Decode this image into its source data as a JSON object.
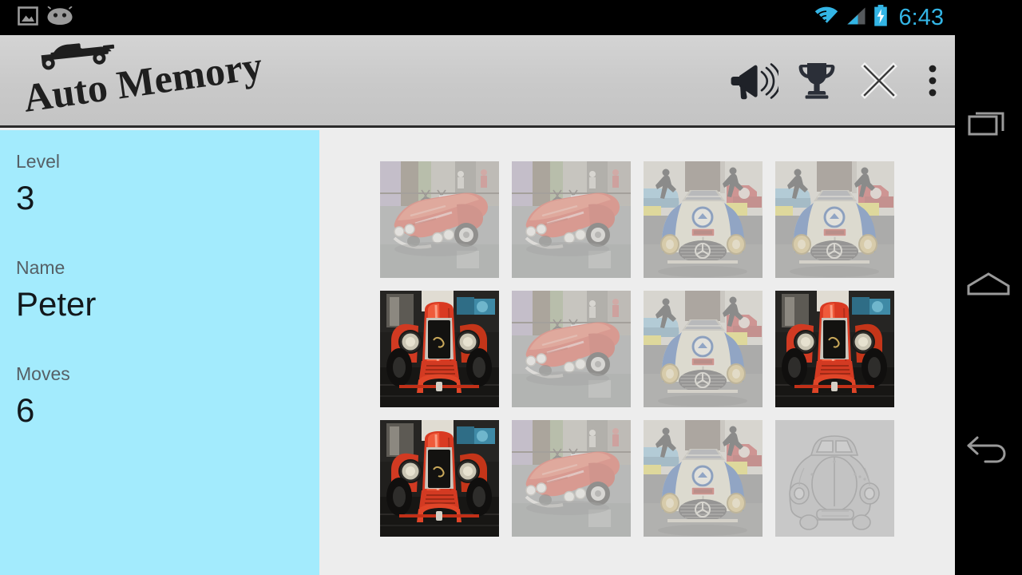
{
  "status_bar": {
    "time": "6:43",
    "left_icons": [
      {
        "name": "screenshot-icon",
        "label": "screenshot"
      },
      {
        "name": "android-bean-icon",
        "label": "android"
      }
    ],
    "right_icons": [
      {
        "name": "wifi-icon",
        "label": "wifi"
      },
      {
        "name": "cellular-signal-icon",
        "label": "signal"
      },
      {
        "name": "battery-charging-icon",
        "label": "battery charging"
      }
    ],
    "accent_color": "#33b5e5",
    "background_color": "#000000"
  },
  "action_bar": {
    "app_title": "Auto Memory",
    "logo_icon": "race-car-icon",
    "background_color": "#c9c9c9",
    "actions": [
      {
        "name": "sound-button",
        "label": "Sound",
        "icon": "megaphone-icon"
      },
      {
        "name": "highscore-button",
        "label": "High Scores",
        "icon": "trophy-icon"
      },
      {
        "name": "close-button",
        "label": "Close",
        "icon": "close-icon"
      },
      {
        "name": "overflow-menu-button",
        "label": "More options",
        "icon": "overflow-menu-icon"
      }
    ]
  },
  "sidebar": {
    "background_color": "#a3ebfd",
    "stats": [
      {
        "label": "Level",
        "value": "3"
      },
      {
        "label": "Name",
        "value": "Peter"
      },
      {
        "label": "Moves",
        "value": "6"
      }
    ]
  },
  "board": {
    "background_color": "#ededed",
    "columns": 4,
    "rows": 3,
    "cards": [
      {
        "position": "r1c1",
        "face": "corvette",
        "state": "revealed-matched"
      },
      {
        "position": "r1c2",
        "face": "corvette",
        "state": "revealed-matched"
      },
      {
        "position": "r1c3",
        "face": "mercedes",
        "state": "revealed-matched"
      },
      {
        "position": "r1c4",
        "face": "mercedes",
        "state": "revealed-matched"
      },
      {
        "position": "r2c1",
        "face": "alfaromeo",
        "state": "revealed"
      },
      {
        "position": "r2c2",
        "face": "corvette",
        "state": "revealed-matched"
      },
      {
        "position": "r2c3",
        "face": "mercedes",
        "state": "revealed-matched"
      },
      {
        "position": "r2c4",
        "face": "alfaromeo",
        "state": "revealed"
      },
      {
        "position": "r3c1",
        "face": "alfaromeo",
        "state": "revealed"
      },
      {
        "position": "r3c2",
        "face": "corvette",
        "state": "revealed-matched"
      },
      {
        "position": "r3c3",
        "face": "mercedes",
        "state": "revealed-matched"
      },
      {
        "position": "r3c4",
        "face": "card-back",
        "state": "face-down"
      }
    ],
    "card_faces": {
      "corvette": "red convertible sports car on street",
      "mercedes": "cream and blue racing coupe in showroom",
      "alfaromeo": "red vintage open-wheel roadster front view",
      "card-back": "embossed grey classic car outline"
    }
  },
  "navigation_bar": {
    "background_color": "#000000",
    "buttons": [
      {
        "name": "recents-button",
        "label": "Recents",
        "icon": "recents-icon"
      },
      {
        "name": "home-button",
        "label": "Home",
        "icon": "home-icon"
      },
      {
        "name": "back-button",
        "label": "Back",
        "icon": "back-arrow-icon"
      }
    ]
  }
}
